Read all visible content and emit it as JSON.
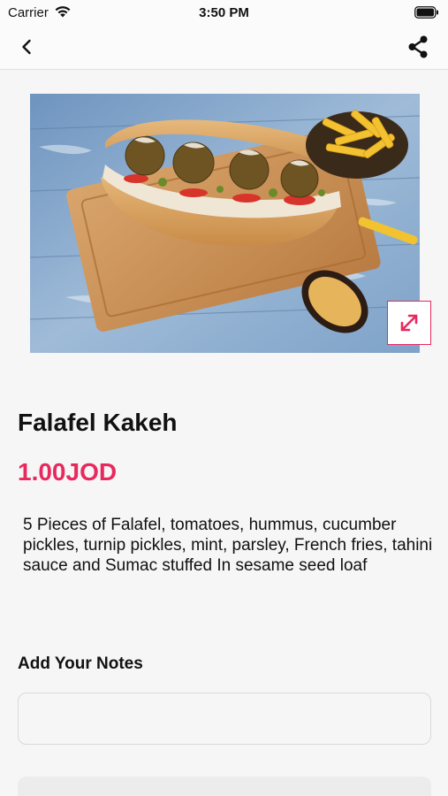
{
  "status_bar": {
    "carrier": "Carrier",
    "time": "3:50 PM",
    "wifi_icon": "wifi-icon",
    "battery_icon": "battery-icon"
  },
  "nav": {
    "back_icon": "chevron-left-icon",
    "share_icon": "share-icon"
  },
  "product": {
    "name": "Falafel Kakeh",
    "price": "1.00JOD",
    "description": "5 Pieces of Falafel, tomatoes, hummus, cucumber pickles, turnip pickles, mint, parsley, French fries, tahini sauce and Sumac stuffed In sesame seed loaf",
    "expand_icon": "expand-icon"
  },
  "notes": {
    "label": "Add Your Notes",
    "value": "",
    "placeholder": ""
  },
  "colors": {
    "accent": "#e8295e",
    "background": "#f6f6f6",
    "text": "#111111"
  }
}
